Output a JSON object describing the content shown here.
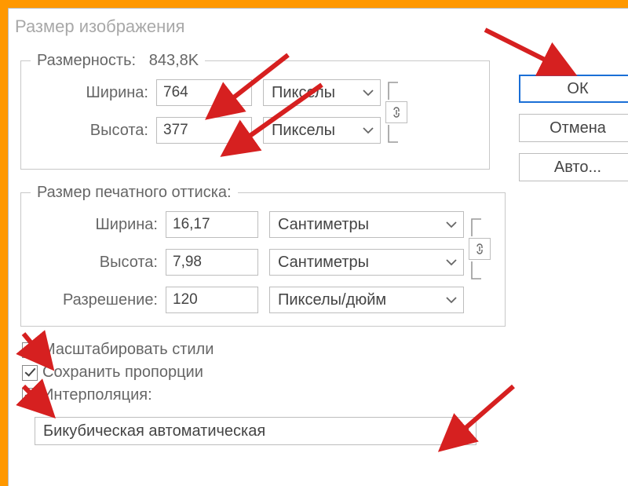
{
  "title": "Размер изображения",
  "dimensions": {
    "legend": "Размерность:",
    "size_value": "843,8K",
    "width_label": "Ширина:",
    "width_value": "764",
    "width_unit": "Пикселы",
    "height_label": "Высота:",
    "height_value": "377",
    "height_unit": "Пикселы"
  },
  "print": {
    "legend": "Размер печатного оттиска:",
    "width_label": "Ширина:",
    "width_value": "16,17",
    "width_unit": "Сантиметры",
    "height_label": "Высота:",
    "height_value": "7,98",
    "height_unit": "Сантиметры",
    "res_label": "Разрешение:",
    "res_value": "120",
    "res_unit": "Пикселы/дюйм"
  },
  "checkboxes": {
    "scale_styles": "Масштабировать стили",
    "preserve_aspect": "Сохранить пропорции",
    "interpolation": "Интерполяция:"
  },
  "interp_method": "Бикубическая автоматическая",
  "buttons": {
    "ok": "ОК",
    "cancel": "Отмена",
    "auto": "Авто..."
  },
  "icons": {
    "link": "link-icon",
    "chevron": "chevron-down-icon"
  }
}
